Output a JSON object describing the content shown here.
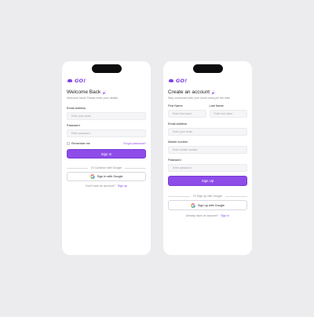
{
  "brand": {
    "name": "GO!",
    "accent": "#8e4ce8"
  },
  "login": {
    "title": "Welcome Back",
    "subtitle": "Welcome back! Please enter your details",
    "email_label": "Email address",
    "email_placeholder": "Enter your email",
    "password_label": "Password",
    "password_placeholder": "Enter password",
    "remember_label": "Remember me",
    "forgot_label": "Forgot password?",
    "submit_label": "Sign In",
    "divider_text": "Or Continue with Google",
    "google_label": "Sign In with Google",
    "footer_text": "Don't have an account?",
    "footer_link": "Sign up"
  },
  "signup": {
    "title": "Create an account",
    "subtitle": "Stay connected with your loved ones join the train",
    "first_name_label": "First Name",
    "first_name_placeholder": "Enter first name",
    "last_name_label": "Last Name",
    "last_name_placeholder": "Enter last name",
    "email_label": "Email address",
    "email_placeholder": "Enter your email",
    "mobile_label": "Mobile number",
    "mobile_placeholder": "Enter mobile number",
    "password_label": "Password",
    "password_placeholder": "Enter password",
    "submit_label": "Sign Up",
    "divider_text": "Or Sign up with Google",
    "google_label": "Sign up with Google",
    "footer_text": "Already have an account?",
    "footer_link": "Sign In"
  }
}
